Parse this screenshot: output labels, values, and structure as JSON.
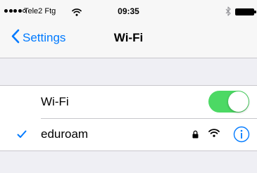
{
  "status_bar": {
    "signal_strength": "4 of 5",
    "carrier": "Tele2 Ftg",
    "time": "09:35"
  },
  "nav": {
    "back_label": "Settings",
    "title": "Wi-Fi"
  },
  "wifi_row": {
    "label": "Wi-Fi",
    "toggle_on": true
  },
  "network_row": {
    "name": "eduroam",
    "connected": true,
    "secured": true
  },
  "colors": {
    "accent": "#007aff",
    "toggle_on": "#4cd964",
    "background": "#efeff4"
  },
  "icons": [
    "chevron-left-icon",
    "wifi-icon",
    "bluetooth-icon",
    "battery-icon",
    "checkmark-icon",
    "lock-icon",
    "info-icon"
  ]
}
